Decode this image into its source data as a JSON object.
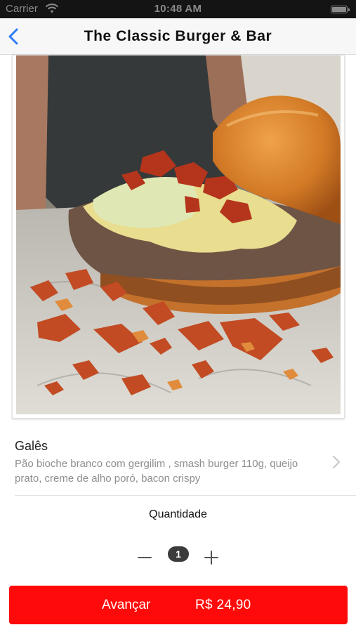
{
  "status_bar": {
    "carrier": "Carrier",
    "time": "10:48 AM"
  },
  "nav": {
    "title": "The Classic Burger & Bar",
    "back_icon": "chevron-left-icon",
    "back_color": "#2f7bf6"
  },
  "product": {
    "image": "burger-photo",
    "name": "Galês",
    "description": "Pão bioche branco com gergilim , smash burger 110g, queijo prato, creme de alho poró, bacon crispy",
    "detail_icon": "chevron-right-icon"
  },
  "quantity": {
    "label": "Quantidade",
    "value": "1",
    "decrement_icon": "minus-icon",
    "increment_icon": "plus-icon"
  },
  "checkout": {
    "button_label": "Avançar",
    "price": "R$ 24,90",
    "color": "#ff0a0a"
  }
}
